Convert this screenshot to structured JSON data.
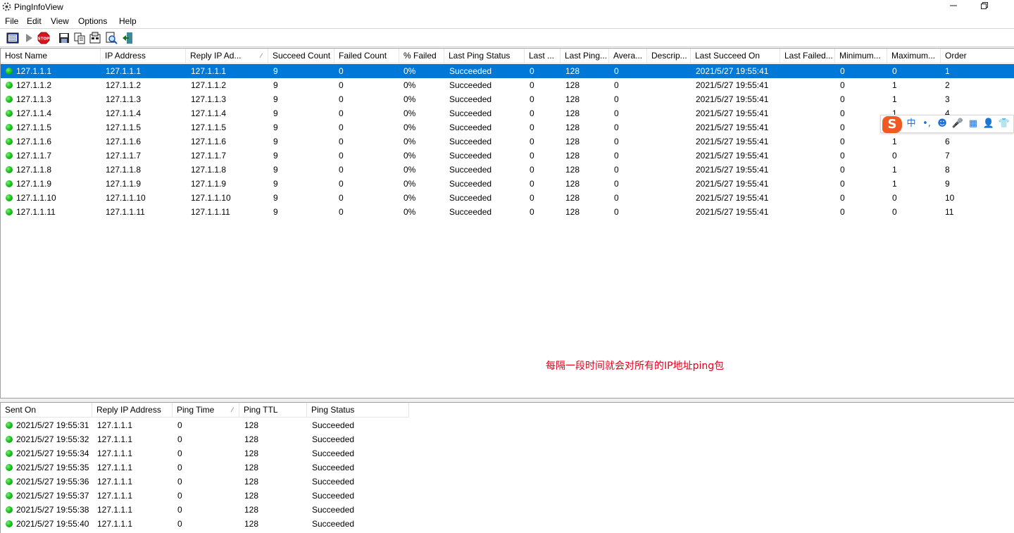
{
  "window": {
    "title": "PingInfoView"
  },
  "menu": [
    "File",
    "Edit",
    "View",
    "Options",
    "Help"
  ],
  "toolbar": [
    "properties",
    "start",
    "stop",
    "save",
    "copy",
    "html-report",
    "find",
    "exit"
  ],
  "upper_table": {
    "columns": [
      "Host Name",
      "IP Address",
      "Reply IP Ad...",
      "Succeed Count",
      "Failed Count",
      "% Failed",
      "Last Ping Status",
      "Last ...",
      "Last Ping...",
      "Avera...",
      "Descrip...",
      "Last Succeed On",
      "Last Failed...",
      "Minimum...",
      "Maximum...",
      "Order"
    ],
    "rows": [
      [
        "127.1.1.1",
        "127.1.1.1",
        "127.1.1.1",
        "9",
        "0",
        "0%",
        "Succeeded",
        "0",
        "128",
        "0",
        "",
        "2021/5/27 19:55:41",
        "",
        "0",
        "0",
        "1"
      ],
      [
        "127.1.1.2",
        "127.1.1.2",
        "127.1.1.2",
        "9",
        "0",
        "0%",
        "Succeeded",
        "0",
        "128",
        "0",
        "",
        "2021/5/27 19:55:41",
        "",
        "0",
        "1",
        "2"
      ],
      [
        "127.1.1.3",
        "127.1.1.3",
        "127.1.1.3",
        "9",
        "0",
        "0%",
        "Succeeded",
        "0",
        "128",
        "0",
        "",
        "2021/5/27 19:55:41",
        "",
        "0",
        "1",
        "3"
      ],
      [
        "127.1.1.4",
        "127.1.1.4",
        "127.1.1.4",
        "9",
        "0",
        "0%",
        "Succeeded",
        "0",
        "128",
        "0",
        "",
        "2021/5/27 19:55:41",
        "",
        "0",
        "1",
        "4"
      ],
      [
        "127.1.1.5",
        "127.1.1.5",
        "127.1.1.5",
        "9",
        "0",
        "0%",
        "Succeeded",
        "0",
        "128",
        "0",
        "",
        "2021/5/27 19:55:41",
        "",
        "0",
        "",
        ""
      ],
      [
        "127.1.1.6",
        "127.1.1.6",
        "127.1.1.6",
        "9",
        "0",
        "0%",
        "Succeeded",
        "0",
        "128",
        "0",
        "",
        "2021/5/27 19:55:41",
        "",
        "0",
        "1",
        "6"
      ],
      [
        "127.1.1.7",
        "127.1.1.7",
        "127.1.1.7",
        "9",
        "0",
        "0%",
        "Succeeded",
        "0",
        "128",
        "0",
        "",
        "2021/5/27 19:55:41",
        "",
        "0",
        "0",
        "7"
      ],
      [
        "127.1.1.8",
        "127.1.1.8",
        "127.1.1.8",
        "9",
        "0",
        "0%",
        "Succeeded",
        "0",
        "128",
        "0",
        "",
        "2021/5/27 19:55:41",
        "",
        "0",
        "1",
        "8"
      ],
      [
        "127.1.1.9",
        "127.1.1.9",
        "127.1.1.9",
        "9",
        "0",
        "0%",
        "Succeeded",
        "0",
        "128",
        "0",
        "",
        "2021/5/27 19:55:41",
        "",
        "0",
        "1",
        "9"
      ],
      [
        "127.1.1.10",
        "127.1.1.10",
        "127.1.1.10",
        "9",
        "0",
        "0%",
        "Succeeded",
        "0",
        "128",
        "0",
        "",
        "2021/5/27 19:55:41",
        "",
        "0",
        "0",
        "10"
      ],
      [
        "127.1.1.11",
        "127.1.1.11",
        "127.1.1.11",
        "9",
        "0",
        "0%",
        "Succeeded",
        "0",
        "128",
        "0",
        "",
        "2021/5/27 19:55:41",
        "",
        "0",
        "0",
        "11"
      ]
    ],
    "selected_row": 0,
    "sorted_column": "Reply IP Ad..."
  },
  "annotation": "每隔一段时间就会对所有的IP地址ping包",
  "lower_table": {
    "columns": [
      "Sent On",
      "Reply IP Address",
      "Ping Time",
      "Ping TTL",
      "Ping Status"
    ],
    "sorted_column": "Ping Time",
    "rows": [
      [
        "2021/5/27 19:55:31",
        "127.1.1.1",
        "0",
        "128",
        "Succeeded"
      ],
      [
        "2021/5/27 19:55:32",
        "127.1.1.1",
        "0",
        "128",
        "Succeeded"
      ],
      [
        "2021/5/27 19:55:34",
        "127.1.1.1",
        "0",
        "128",
        "Succeeded"
      ],
      [
        "2021/5/27 19:55:35",
        "127.1.1.1",
        "0",
        "128",
        "Succeeded"
      ],
      [
        "2021/5/27 19:55:36",
        "127.1.1.1",
        "0",
        "128",
        "Succeeded"
      ],
      [
        "2021/5/27 19:55:37",
        "127.1.1.1",
        "0",
        "128",
        "Succeeded"
      ],
      [
        "2021/5/27 19:55:38",
        "127.1.1.1",
        "0",
        "128",
        "Succeeded"
      ],
      [
        "2021/5/27 19:55:40",
        "127.1.1.1",
        "0",
        "128",
        "Succeeded"
      ]
    ]
  },
  "ime_bar": {
    "logo": "S",
    "items": [
      {
        "icon": "chinese-mode-icon",
        "text": "中"
      },
      {
        "icon": "punctuation-icon",
        "text": "•,"
      },
      {
        "icon": "emoji-icon",
        "text": "☻"
      },
      {
        "icon": "microphone-icon",
        "text": "🎤"
      },
      {
        "icon": "keyboard-icon",
        "text": "▦"
      },
      {
        "icon": "user-icon",
        "text": "👤"
      },
      {
        "icon": "skin-icon",
        "text": "👕"
      }
    ]
  },
  "colors": {
    "selection": "#0078d7",
    "status_ok": "#1fc51f",
    "annotation": "#e0001a"
  }
}
